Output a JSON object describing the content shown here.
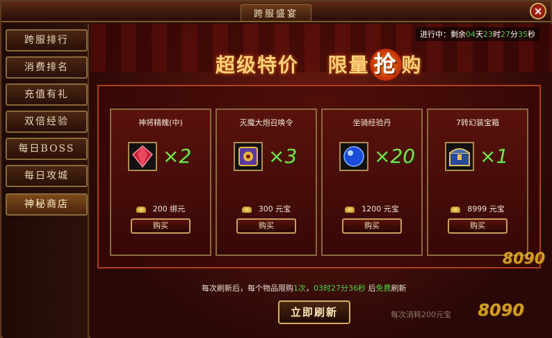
{
  "window": {
    "title": "跨服盛宴",
    "close_label": "×"
  },
  "sidebar": {
    "items": [
      {
        "label": "跨服排行"
      },
      {
        "label": "消费排名"
      },
      {
        "label": "充值有礼"
      },
      {
        "label": "双倍经验"
      },
      {
        "label": "每日BOSS"
      },
      {
        "label": "每日攻城"
      },
      {
        "label": "神秘商店",
        "active": true
      }
    ]
  },
  "timer": {
    "prefix": "进行中：剩余",
    "days": "04",
    "days_unit": "天",
    "hours": "23",
    "hours_unit": "时",
    "minutes": "27",
    "minutes_unit": "分",
    "seconds": "35",
    "seconds_unit": "秒"
  },
  "banner": {
    "part1": "超级特价",
    "part2": "限量",
    "highlight": "抢",
    "part3": "购"
  },
  "items": [
    {
      "name": "神将精魄(中)",
      "qty": "×2",
      "price": "200",
      "currency": "绑元",
      "buy_label": "购买",
      "icon": "red-gem-icon",
      "color": "#c8203a"
    },
    {
      "name": "灭魔大炮召唤令",
      "qty": "×3",
      "price": "300",
      "currency": "元宝",
      "buy_label": "购买",
      "icon": "summon-token-icon",
      "color": "#d8a020"
    },
    {
      "name": "坐骑经验丹",
      "qty": "×20",
      "price": "1200",
      "currency": "元宝",
      "buy_label": "购买",
      "icon": "blue-orb-icon",
      "color": "#1a5ad8"
    },
    {
      "name": "7转幻装宝箱",
      "qty": "×1",
      "price": "8999",
      "currency": "元宝",
      "buy_label": "购买",
      "icon": "treasure-chest-icon",
      "color": "#3a6ab8"
    }
  ],
  "refresh": {
    "note_a": "每次刷新后，每个物品限购",
    "limit": "1次",
    "note_b": "，",
    "countdown": "03时27分36秒",
    "note_c": " 后",
    "free": "免费",
    "note_d": "刷新",
    "button_label": "立即刷新",
    "cost_note": "每次消耗200元宝"
  },
  "watermark": {
    "logo": "8090"
  }
}
